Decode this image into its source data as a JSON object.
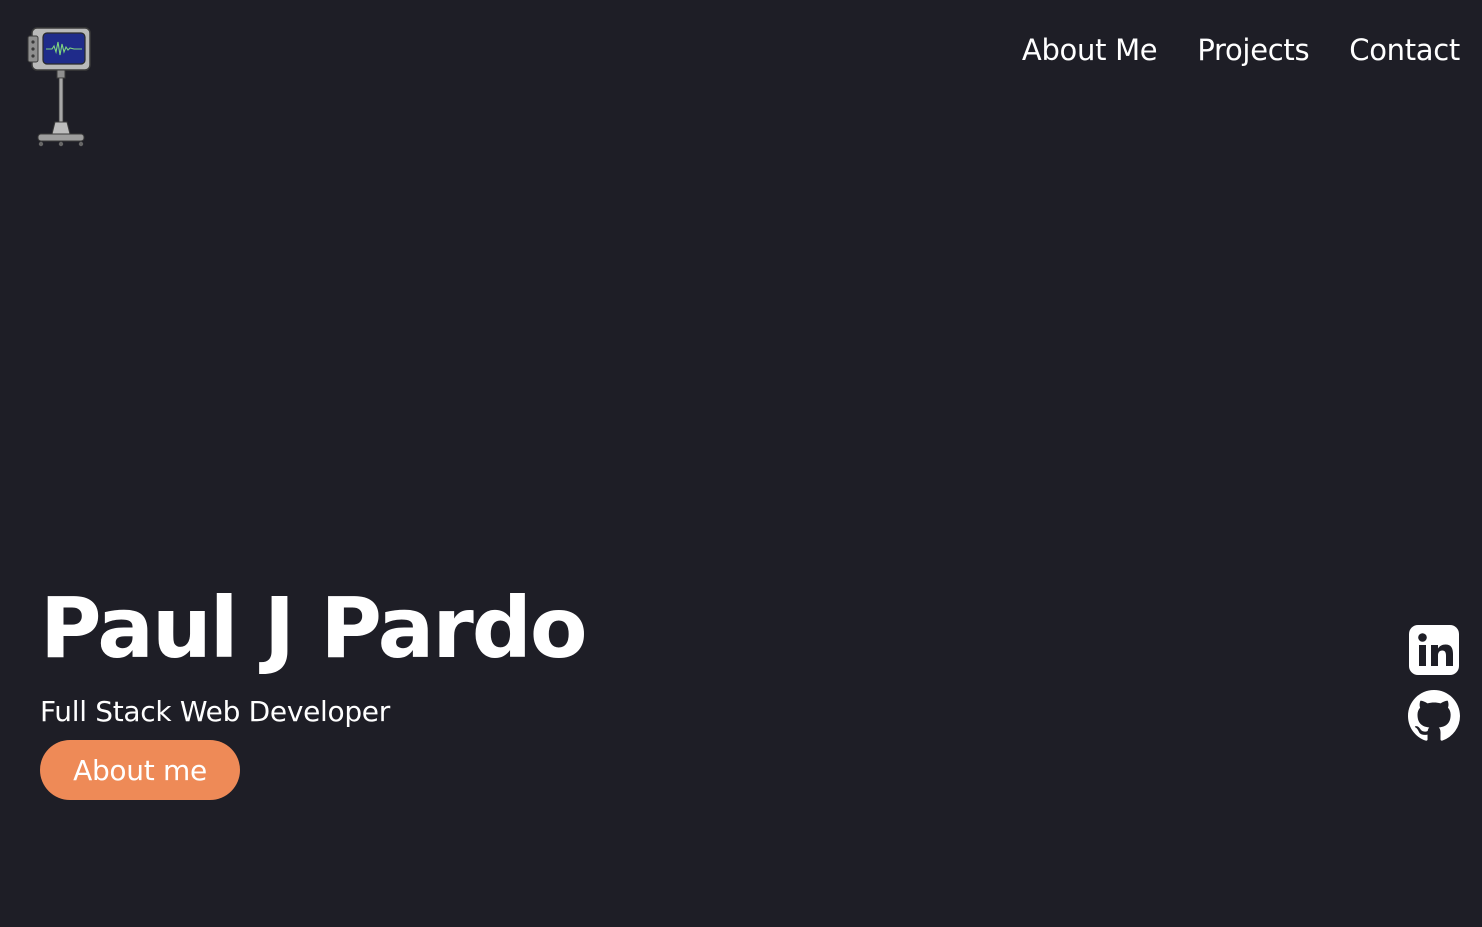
{
  "logo": {
    "icon": "retro-monitor-robot-logo",
    "alt": "Site logo"
  },
  "nav": {
    "items": [
      {
        "label": "About Me"
      },
      {
        "label": "Projects"
      },
      {
        "label": "Contact"
      }
    ]
  },
  "hero": {
    "title": "Paul J Pardo",
    "subtitle": "Full Stack Web Developer",
    "button_label": "About me"
  },
  "socials": [
    {
      "icon": "linkedin-icon",
      "label": "LinkedIn"
    },
    {
      "icon": "github-icon",
      "label": "GitHub"
    }
  ],
  "colors": {
    "background": "#1e1e26",
    "text": "#ffffff",
    "accent": "#ee8a57",
    "logo_screen": "#1f2b8a",
    "logo_body": "#9a9a9a"
  }
}
